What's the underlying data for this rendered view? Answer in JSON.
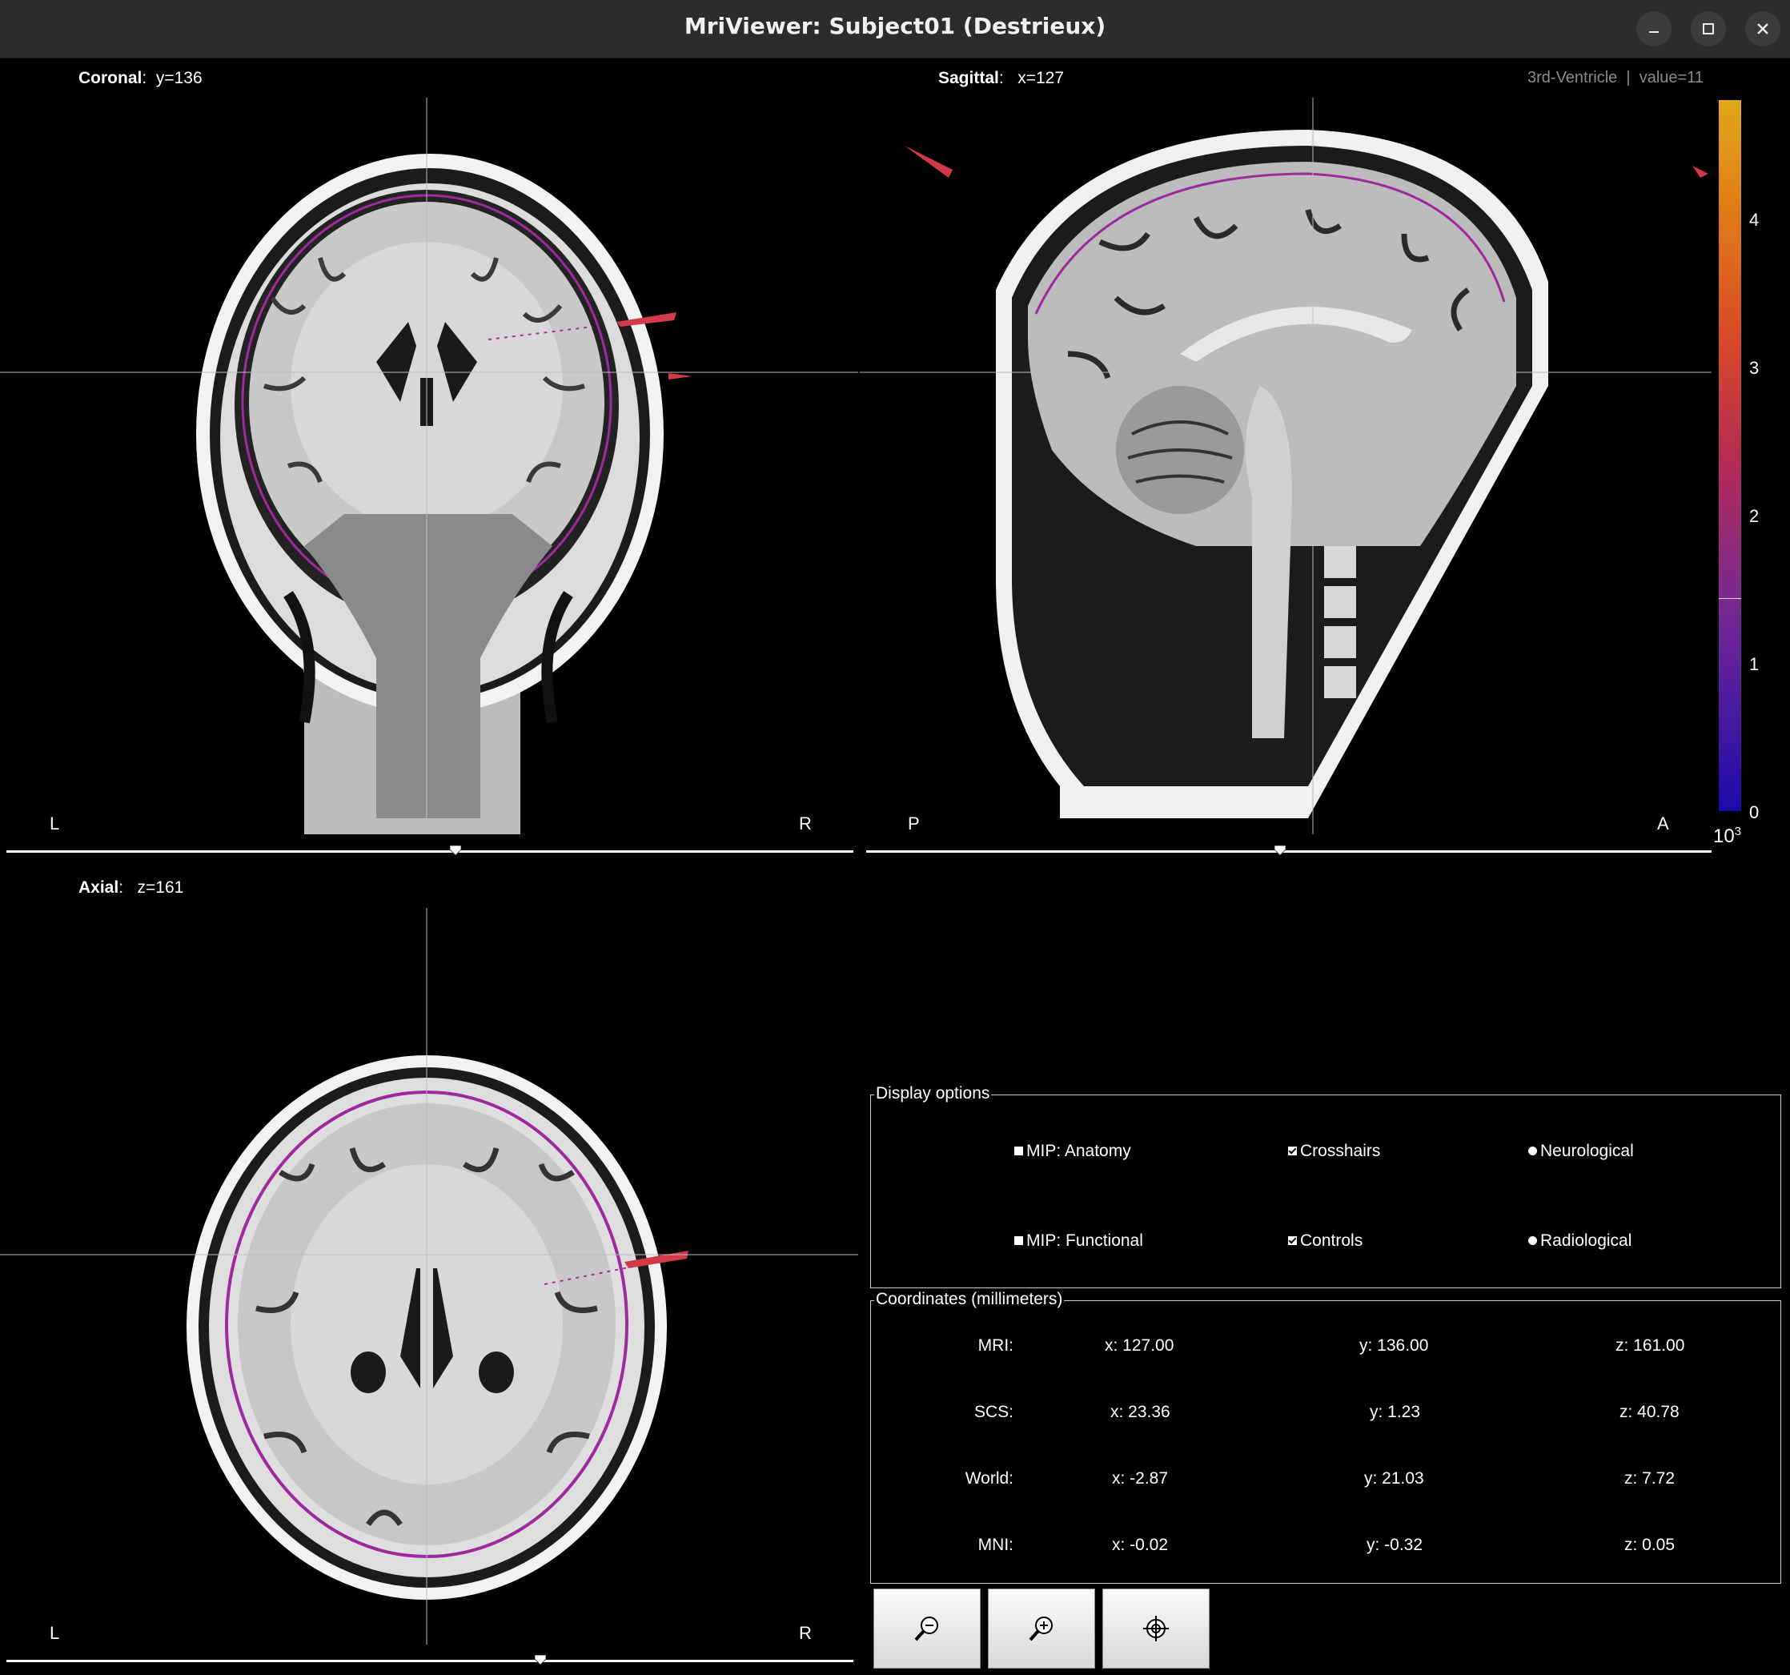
{
  "window": {
    "title": "MriViewer: Subject01 (Destrieux)",
    "controls": [
      "minimize-icon",
      "maximize-icon",
      "close-icon"
    ]
  },
  "views": {
    "coronal": {
      "name": "Coronal",
      "coord": "y=136",
      "left": "L",
      "right": "R",
      "slider_fraction": 0.53
    },
    "sagittal": {
      "name": "Sagittal",
      "coord": "x=127",
      "left": "P",
      "right": "A",
      "slider_fraction": 0.49
    },
    "axial": {
      "name": "Axial",
      "coord": "z=161",
      "left": "L",
      "right": "R",
      "slider_fraction": 0.63
    }
  },
  "hover_info": {
    "label": "3rd-Ventricle",
    "separator": "|",
    "value": "value=11"
  },
  "colorbar": {
    "ticks": [
      "4",
      "3",
      "2",
      "1",
      "0"
    ],
    "exponent_base": "10",
    "exponent": "3",
    "colors": [
      "#e0a81a",
      "#d84828",
      "#7a2a90",
      "#1b0aa8"
    ]
  },
  "display_options": {
    "title": "Display options",
    "mip_anatomy": "MIP: Anatomy",
    "mip_functional": "MIP: Functional",
    "crosshairs": "Crosshairs",
    "controls": "Controls",
    "neurological": "Neurological",
    "radiological": "Radiological"
  },
  "coordinates": {
    "title": "Coordinates (millimeters)",
    "rows": [
      {
        "label": "MRI:",
        "x": "x: 127.00",
        "y": "y: 136.00",
        "z": "z: 161.00"
      },
      {
        "label": "SCS:",
        "x": "x: 23.36",
        "y": "y: 1.23",
        "z": "z: 40.78"
      },
      {
        "label": "World:",
        "x": "x: -2.87",
        "y": "y: 21.03",
        "z": "z: 7.72"
      },
      {
        "label": "MNI:",
        "x": "x: -0.02",
        "y": "y: -0.32",
        "z": "z: 0.05"
      }
    ]
  },
  "toolbar": {
    "buttons": [
      "zoom-out-icon",
      "zoom-in-icon",
      "set-coordinates-icon"
    ]
  }
}
